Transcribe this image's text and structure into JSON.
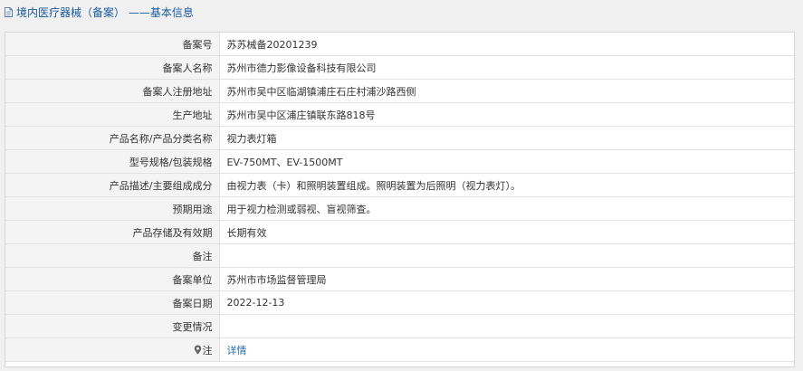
{
  "header": {
    "title": "境内医疗器械（备案） ——基本信息"
  },
  "rows": [
    {
      "label": "备案号",
      "value": "苏苏械备20201239"
    },
    {
      "label": "备案人名称",
      "value": "苏州市德力影像设备科技有限公司"
    },
    {
      "label": "备案人注册地址",
      "value": "苏州市吴中区临湖镇浦庄石庄村浦沙路西侧"
    },
    {
      "label": "生产地址",
      "value": "苏州市吴中区浦庄镇联东路818号"
    },
    {
      "label": "产品名称/产品分类名称",
      "value": "视力表灯箱"
    },
    {
      "label": "型号规格/包装规格",
      "value": "EV-750MT、EV-1500MT"
    },
    {
      "label": "产品描述/主要组成成分",
      "value": "由视力表（卡）和照明装置组成。照明装置为后照明（视力表灯）。"
    },
    {
      "label": "预期用途",
      "value": "用于视力检测或弱视、盲视筛查。"
    },
    {
      "label": "产品存储及有效期",
      "value": "长期有效"
    },
    {
      "label": "备注",
      "value": ""
    },
    {
      "label": "备案单位",
      "value": "苏州市市场监督管理局"
    },
    {
      "label": "备案日期",
      "value": "2022-12-13"
    },
    {
      "label": "变更情况",
      "value": ""
    }
  ],
  "note": {
    "label": "注",
    "link_text": "详情",
    "icon": "location-pin-icon"
  }
}
